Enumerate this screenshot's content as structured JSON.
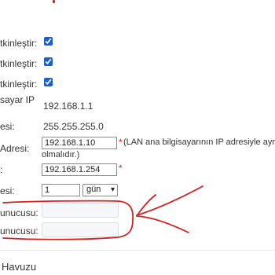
{
  "rows": {
    "enable1_label": "tkinleştir:",
    "enable2_label": "tkinleştir:",
    "enable3_label": "tkinleştir:",
    "ip_label": "sayar IP",
    "ip_value": "192.168.1.1",
    "mask_label": "esi:",
    "mask_value": "255.255.255.0",
    "start_label": "Adresi:",
    "start_value": "192.168.1.10",
    "start_note_line1": "(LAN ana bilgisayarının IP adresiyle aynı",
    "start_note_line2": "olmalıdır.)",
    "end_label": ":",
    "end_value": "192.168.1.254",
    "lease_label": "esi:",
    "lease_value": "1",
    "lease_unit": "gün",
    "dns1_label": "unucusu:",
    "dns1_value": "",
    "dns2_label": "unucusu:",
    "dns2_value": ""
  },
  "required_marker": "*",
  "section_title": "Havuzu",
  "checkboxes": {
    "enable1": true,
    "enable2": true,
    "enable3": true
  },
  "colors": {
    "annotation": "#d42020",
    "checkbox": "#1a5fd0",
    "required": "#e02020"
  }
}
